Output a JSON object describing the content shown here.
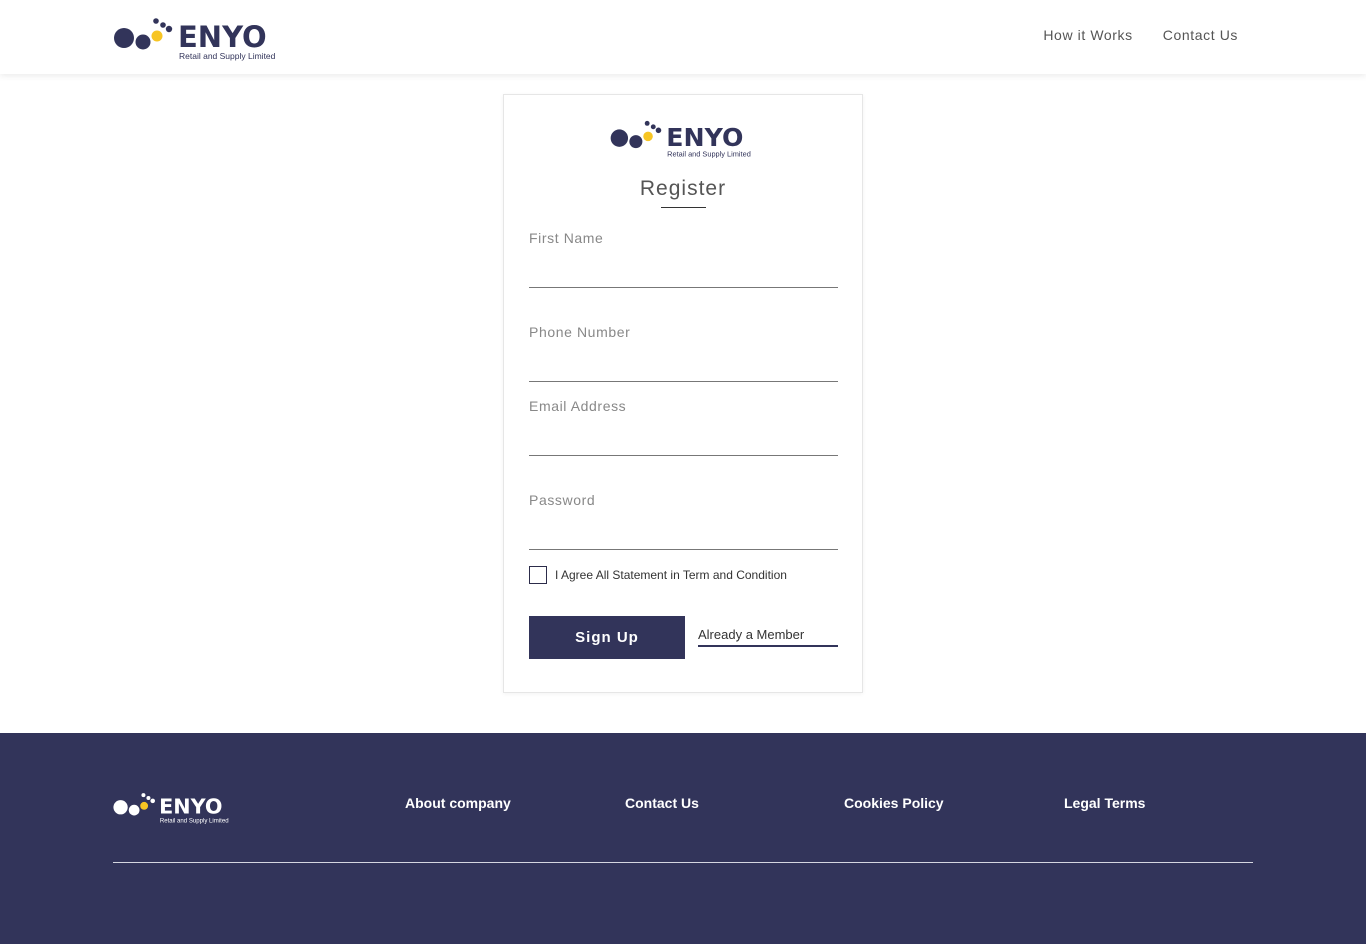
{
  "brand": {
    "name": "ENYO",
    "tagline": "Retail and Supply Limited",
    "colors": {
      "navy": "#32345a",
      "yellow": "#f7c523",
      "white": "#ffffff"
    }
  },
  "nav": {
    "links": [
      "How it Works",
      "Contact Us"
    ]
  },
  "form": {
    "title": "Register",
    "fields": [
      {
        "label": "First Name",
        "value": ""
      },
      {
        "label": "Phone Number",
        "value": ""
      },
      {
        "label": "Email Address",
        "value": ""
      },
      {
        "label": "Password",
        "value": ""
      }
    ],
    "agree_text": "I Agree All Statement in Term and Condition",
    "signup_label": "Sign Up",
    "member_link": "Already a Member"
  },
  "footer": {
    "links": [
      "About company",
      "Contact Us",
      "Cookies Policy",
      "Legal Terms"
    ]
  },
  "icons": [
    "enyo-logo",
    "checkbox-icon"
  ]
}
